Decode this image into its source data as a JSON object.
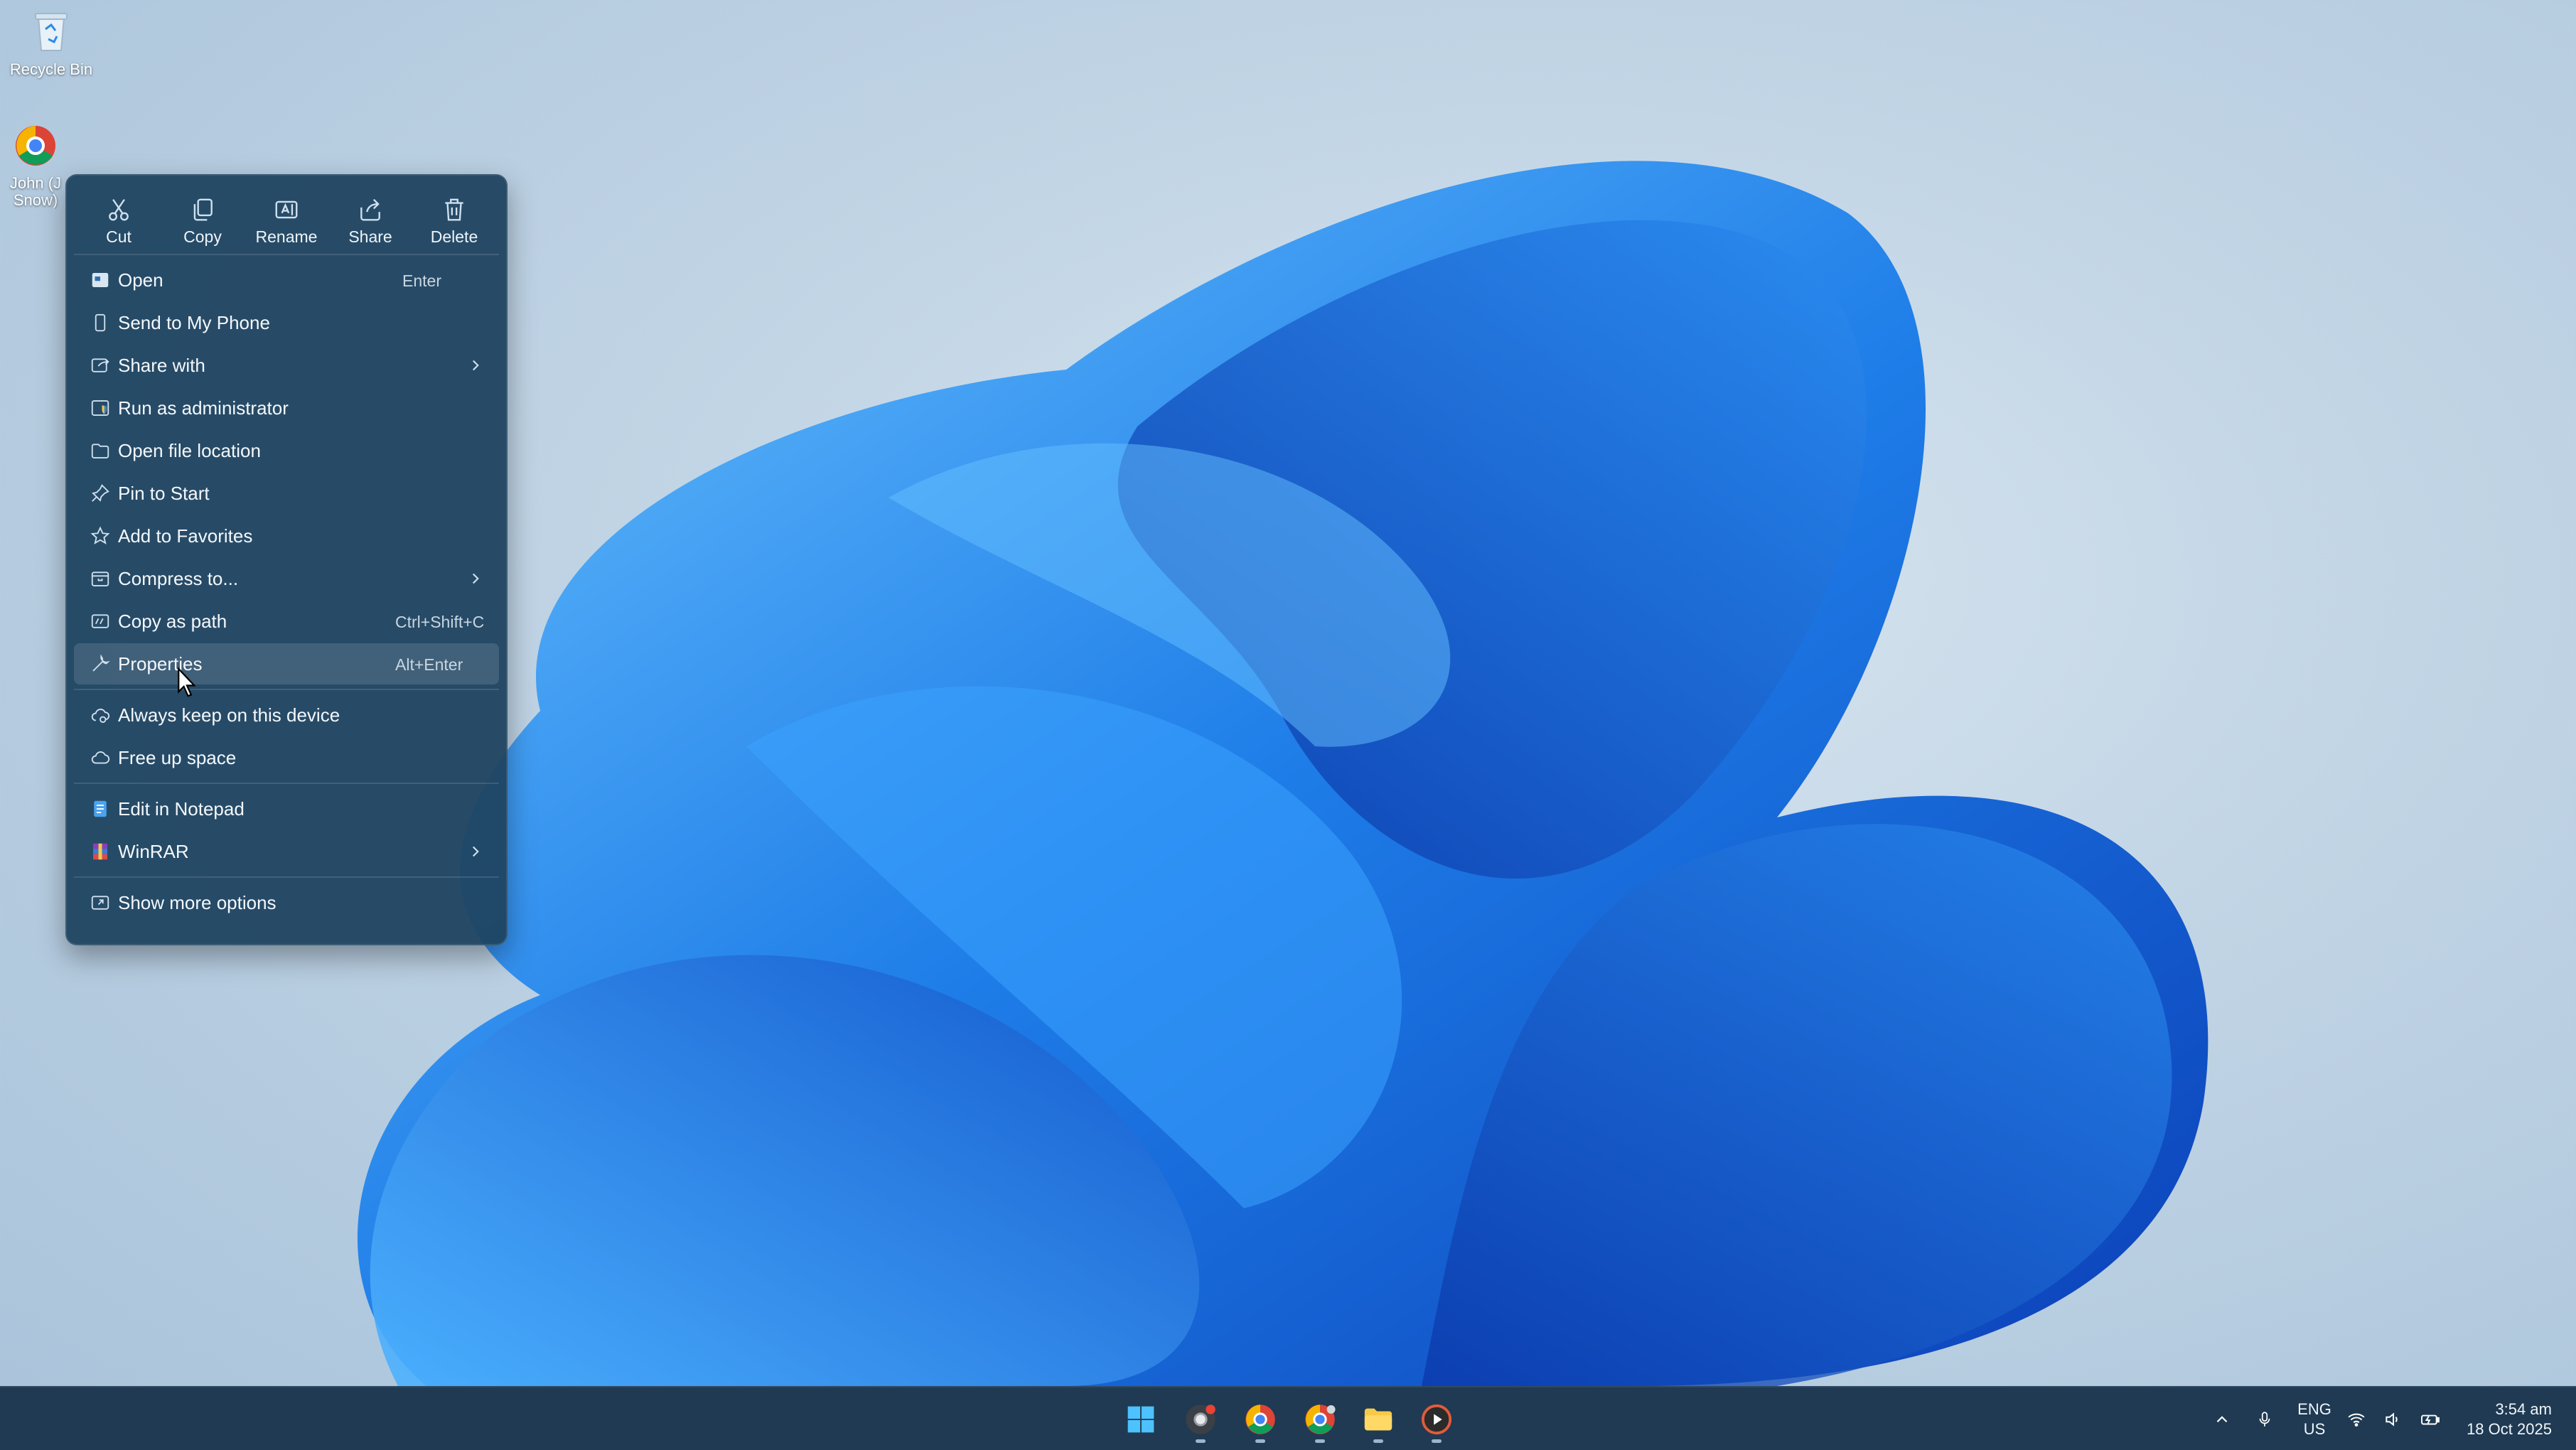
{
  "desktop": {
    "icons": [
      {
        "label": "Recycle Bin",
        "icon": "recycle-bin-icon"
      },
      {
        "label": "John (J Snow)",
        "icon": "chrome-profile-icon"
      }
    ]
  },
  "context_menu": {
    "quick_actions": [
      {
        "label": "Cut",
        "icon": "scissors-icon"
      },
      {
        "label": "Copy",
        "icon": "copy-icon"
      },
      {
        "label": "Rename",
        "icon": "rename-icon"
      },
      {
        "label": "Share",
        "icon": "share-icon"
      },
      {
        "label": "Delete",
        "icon": "trash-icon"
      }
    ],
    "items": [
      {
        "label": "Open",
        "shortcut": "Enter",
        "icon": "open-icon"
      },
      {
        "label": "Send to My Phone",
        "shortcut": "",
        "icon": "phone-icon"
      },
      {
        "label": "Share with",
        "shortcut": "",
        "icon": "share-with-icon",
        "submenu": true
      },
      {
        "label": "Run as administrator",
        "shortcut": "",
        "icon": "shield-icon"
      },
      {
        "label": "Open file location",
        "shortcut": "",
        "icon": "folder-icon"
      },
      {
        "label": "Pin to Start",
        "shortcut": "",
        "icon": "pin-icon"
      },
      {
        "label": "Add to Favorites",
        "shortcut": "",
        "icon": "star-icon"
      },
      {
        "label": "Compress to...",
        "shortcut": "",
        "icon": "archive-icon",
        "submenu": true
      },
      {
        "label": "Copy as path",
        "shortcut": "Ctrl+Shift+C",
        "icon": "path-icon"
      },
      {
        "label": "Properties",
        "shortcut": "Alt+Enter",
        "icon": "wrench-icon",
        "hovered": true
      },
      {
        "label": "Always keep on this device",
        "shortcut": "",
        "icon": "cloud-sync-icon"
      },
      {
        "label": "Free up space",
        "shortcut": "",
        "icon": "cloud-icon"
      },
      {
        "label": "Edit in Notepad",
        "shortcut": "",
        "icon": "notepad-icon"
      },
      {
        "label": "WinRAR",
        "shortcut": "",
        "icon": "winrar-icon",
        "submenu": true
      },
      {
        "label": "Show more options",
        "shortcut": "",
        "icon": "more-options-icon"
      }
    ]
  },
  "taskbar": {
    "apps": [
      {
        "name": "start",
        "icon": "windows-start-icon"
      },
      {
        "name": "app-1",
        "icon": "chrome-badge-icon"
      },
      {
        "name": "app-2",
        "icon": "chrome-icon"
      },
      {
        "name": "app-3",
        "icon": "chrome-profile-icon"
      },
      {
        "name": "app-4",
        "icon": "file-explorer-icon"
      },
      {
        "name": "app-5",
        "icon": "media-player-icon"
      }
    ],
    "tray": {
      "language_line1": "ENG",
      "language_line2": "US",
      "time": "3:54 am",
      "date": "18 Oct 2025"
    }
  },
  "colors": {
    "menu_bg": "#1f4360",
    "taskbar_bg": "#1f3a52",
    "wallpaper_accent": "#1a6fe0"
  }
}
